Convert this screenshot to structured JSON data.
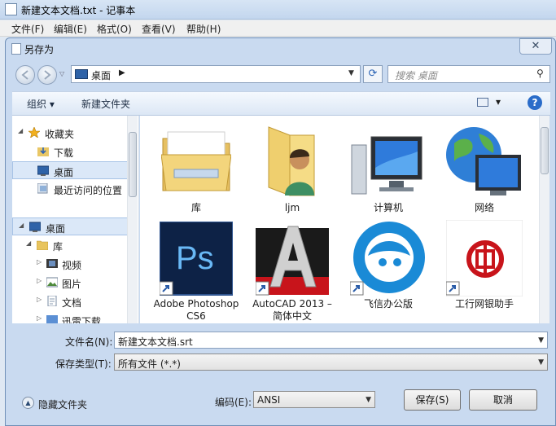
{
  "notepad": {
    "title": "新建文本文档.txt - 记事本",
    "menu": [
      "文件(F)",
      "编辑(E)",
      "格式(O)",
      "查看(V)",
      "帮助(H)"
    ]
  },
  "dialog": {
    "title": "另存为",
    "close_glyph": "✕",
    "address": {
      "location": "桌面",
      "chevron": "▶",
      "dropdown": "▼"
    },
    "refresh_glyph": "⟳",
    "search": {
      "placeholder": "搜索 桌面",
      "icon_glyph": "⚲"
    },
    "toolbar": {
      "organize": "组织 ▾",
      "new_folder": "新建文件夹",
      "view_glyph": "▾",
      "help_glyph": "?"
    },
    "nav": [
      {
        "label": "收藏夹",
        "kind": "star"
      },
      {
        "label": "下载",
        "kind": "download"
      },
      {
        "label": "桌面",
        "kind": "desktop",
        "selected": true
      },
      {
        "label": "最近访问的位置",
        "kind": "recent"
      },
      {
        "label": "桌面",
        "kind": "desktop",
        "selected": true
      },
      {
        "label": "库",
        "kind": "library"
      },
      {
        "label": "视频",
        "kind": "video"
      },
      {
        "label": "图片",
        "kind": "picture"
      },
      {
        "label": "文档",
        "kind": "doc"
      },
      {
        "label": "迅雷下载",
        "kind": "thunder"
      }
    ],
    "files": [
      {
        "label": "库"
      },
      {
        "label": "ljm"
      },
      {
        "label": "计算机"
      },
      {
        "label": "网络"
      },
      {
        "label": "Adobe Photoshop CS6",
        "ps_text": "Ps"
      },
      {
        "label": "AutoCAD 2013 – 简体中文"
      },
      {
        "label": "飞信办公版"
      },
      {
        "label": "工行网银助手"
      }
    ],
    "filename": {
      "label": "文件名(N):",
      "value": "新建文本文档.srt"
    },
    "filetype": {
      "label": "保存类型(T):",
      "value": "所有文件  (*.*)"
    },
    "hide_folders": "隐藏文件夹",
    "encoding": {
      "label": "编码(E):",
      "value": "ANSI"
    },
    "save_button": "保存(S)",
    "cancel_button": "取消"
  },
  "colors": {
    "accent": "#2a6cc9",
    "selection": "#dbe8f8",
    "frame": "#c9daf0"
  }
}
